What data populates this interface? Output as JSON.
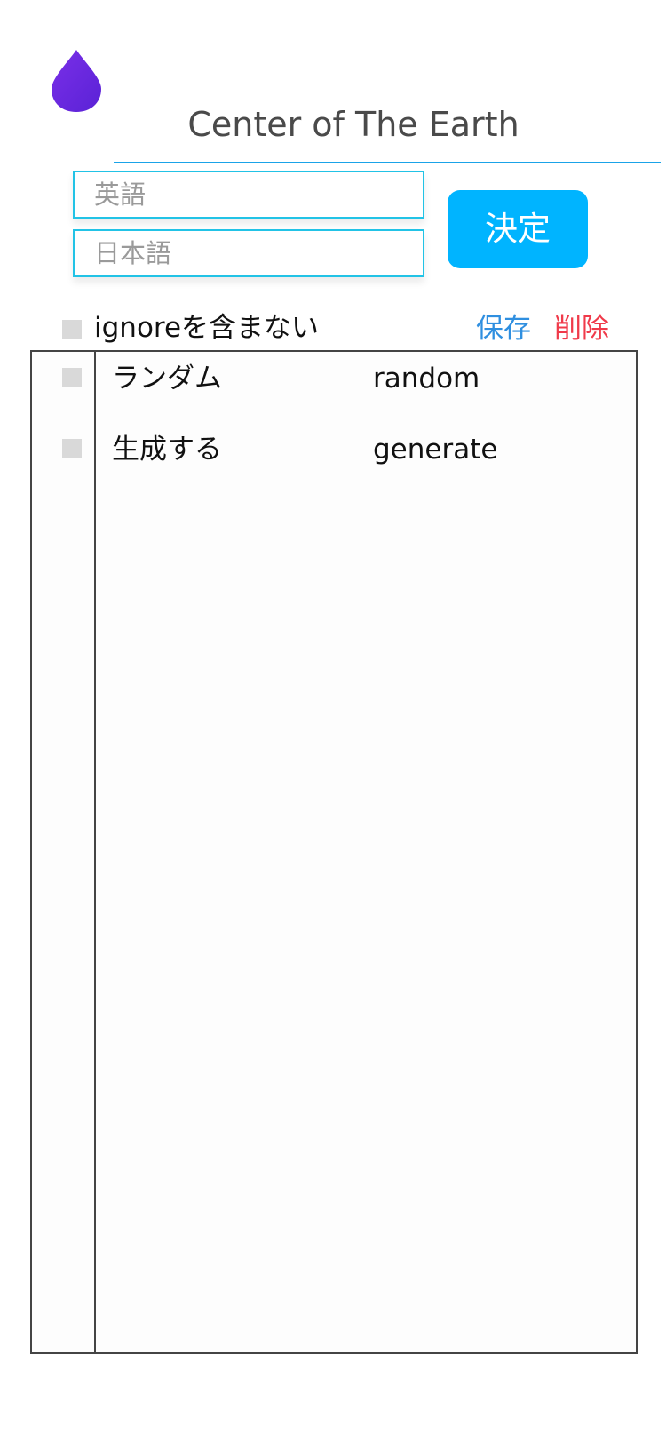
{
  "app": {
    "logo": "water-drop",
    "title": "Center of The Earth",
    "accent_color": "#00b4ff",
    "logo_color": "#6a2ee0"
  },
  "form": {
    "english_placeholder": "英語",
    "japanese_placeholder": "日本語",
    "english_value": "",
    "japanese_value": "",
    "submit_label": "決定"
  },
  "toolbar": {
    "ignore_label": "ignoreを含まない",
    "ignore_checked": false,
    "save_label": "保存",
    "delete_label": "削除"
  },
  "words": [
    {
      "japanese": "ランダム",
      "english": "random",
      "checked": false
    },
    {
      "japanese": "生成する",
      "english": "generate",
      "checked": false
    }
  ]
}
